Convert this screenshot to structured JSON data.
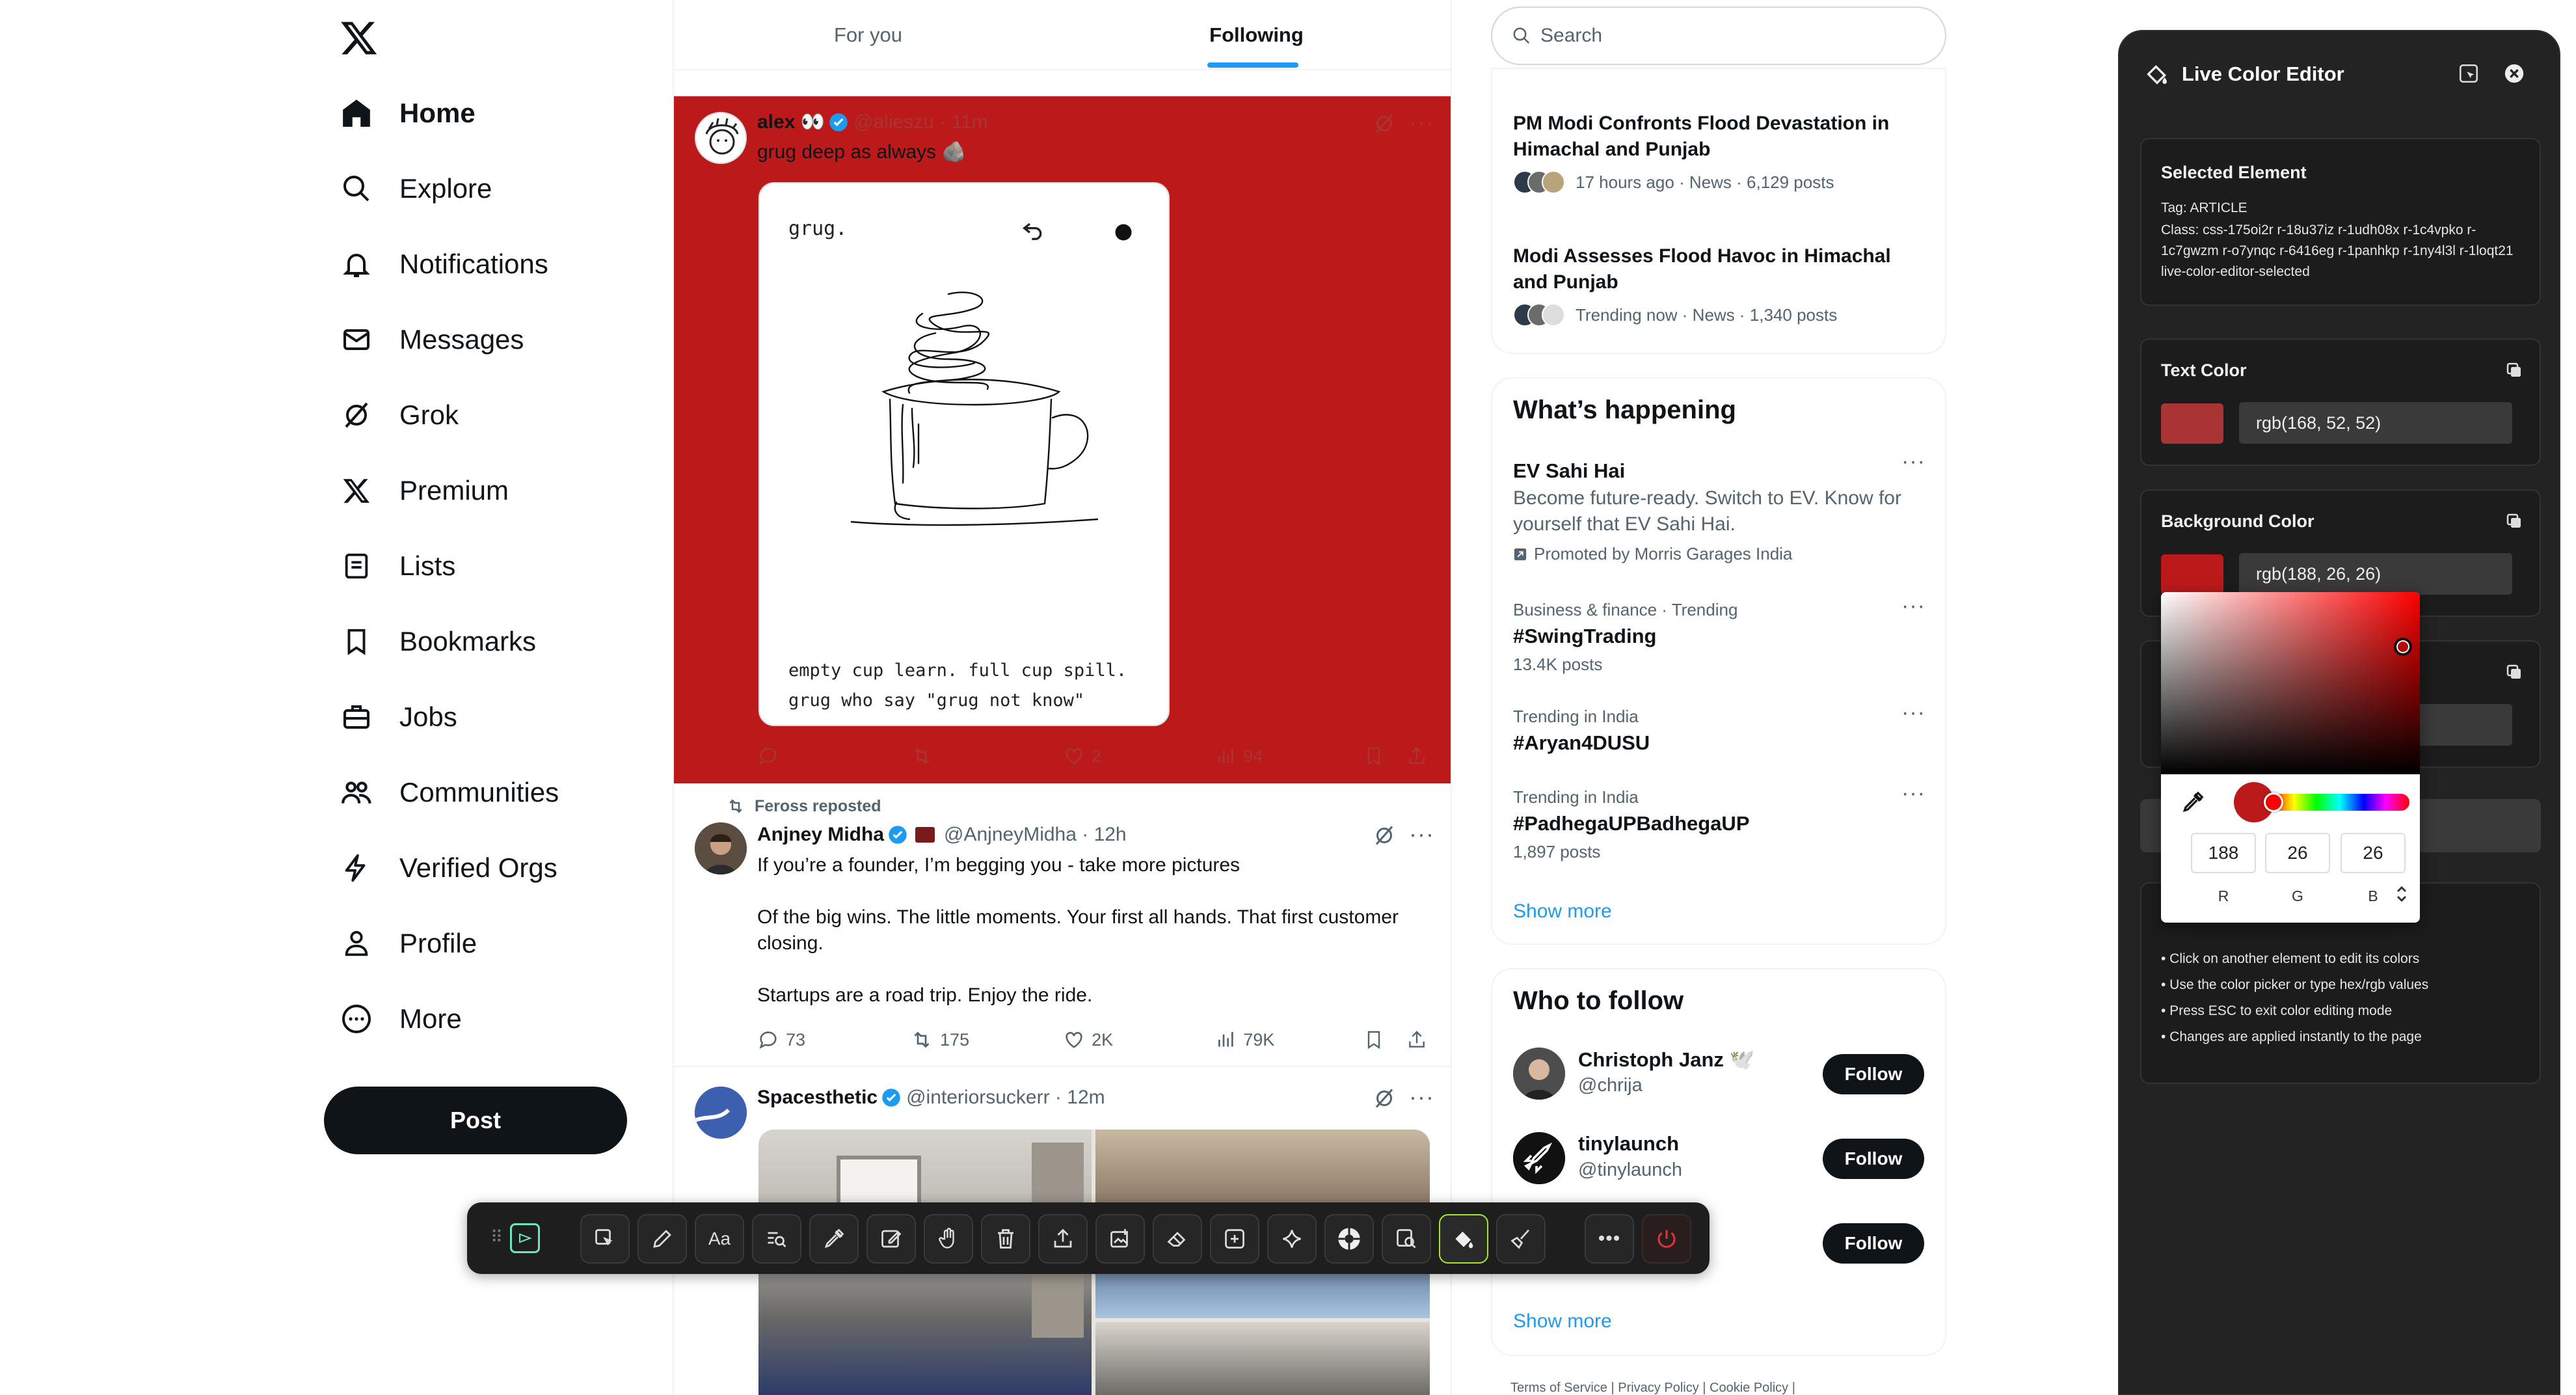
{
  "nav": {
    "items": [
      {
        "label": "Home",
        "icon": "home-icon"
      },
      {
        "label": "Explore",
        "icon": "search-icon"
      },
      {
        "label": "Notifications",
        "icon": "bell-icon"
      },
      {
        "label": "Messages",
        "icon": "envelope-icon"
      },
      {
        "label": "Grok",
        "icon": "grok-icon"
      },
      {
        "label": "Premium",
        "icon": "x-icon"
      },
      {
        "label": "Lists",
        "icon": "list-icon"
      },
      {
        "label": "Bookmarks",
        "icon": "bookmark-icon"
      },
      {
        "label": "Jobs",
        "icon": "briefcase-icon"
      },
      {
        "label": "Communities",
        "icon": "people-icon"
      },
      {
        "label": "Verified Orgs",
        "icon": "lightning-icon"
      },
      {
        "label": "Profile",
        "icon": "person-icon"
      },
      {
        "label": "More",
        "icon": "more-circle-icon"
      }
    ],
    "post_label": "Post"
  },
  "feed": {
    "tabs": [
      "For you",
      "Following"
    ],
    "active_tab": "Following",
    "tweets": [
      {
        "name": "alex 👀",
        "handle": "@alieszu · 11m",
        "text": "grug deep as always 🪨",
        "card": {
          "heading": "grug.",
          "line1": "empty cup learn. full cup spill.",
          "line2": "grug who say \"grug not know\""
        },
        "replies": "",
        "retweets": "",
        "likes": "2",
        "views": "94"
      },
      {
        "repost_note": "Feross reposted",
        "name": "Anjney Midha",
        "handle": "@AnjneyMidha · 12h",
        "text_lines": [
          "If you’re a founder, I’m begging you - take more pictures",
          "Of the big wins. The little moments. Your first all hands. That first customer closing.",
          "Startups are a road trip. Enjoy the ride."
        ],
        "replies": "73",
        "retweets": "175",
        "likes": "2K",
        "views": "79K"
      },
      {
        "name": "Spacesthetic",
        "handle": "@interiorsuckerr · 12m"
      }
    ]
  },
  "right": {
    "search_placeholder": "Search",
    "news": [
      {
        "title": "PM Modi Confronts Flood Devastation in Himachal and Punjab",
        "meta": "17 hours ago · News · 6,129 posts"
      },
      {
        "title": "Modi Assesses Flood Havoc in Himachal and Punjab",
        "meta": "Trending now · News · 1,340 posts"
      }
    ],
    "happening": {
      "title": "What’s happening",
      "promo": {
        "name": "EV Sahi Hai",
        "desc": "Become future-ready. Switch to EV. Know for yourself that EV Sahi Hai.",
        "by": "Promoted by Morris Garages India"
      },
      "trends": [
        {
          "cat": "Business & finance · Trending",
          "name": "#SwingTrading",
          "posts": "13.4K posts"
        },
        {
          "cat": "Trending in India",
          "name": "#Aryan4DUSU",
          "posts": ""
        },
        {
          "cat": "Trending in India",
          "name": "#PadhegaUPBadhegaUP",
          "posts": "1,897 posts"
        }
      ],
      "show_more": "Show more"
    },
    "who_to_follow": {
      "title": "Who to follow",
      "people": [
        {
          "name": "Christoph Janz 🕊️",
          "handle": "@chrija"
        },
        {
          "name": "tinylaunch",
          "handle": "@tinylaunch"
        },
        {
          "name": "",
          "handle": ""
        }
      ],
      "follow_label": "Follow",
      "show_more": "Show more"
    },
    "footer": "Terms of Service  |  Privacy Policy  |  Cookie Policy  |"
  },
  "editor": {
    "title": "Live Color Editor",
    "selected": {
      "heading": "Selected Element",
      "tag": "Tag: ARTICLE",
      "class": "Class: css-175oi2r r-18u37iz r-1udh08x r-1c4vpko r-1c7gwzm r-o7ynqc r-6416eg r-1panhkp r-1ny4l3l r-1loqt21 live-color-editor-selected"
    },
    "text_color": {
      "label": "Text Color",
      "value": "rgb(168, 52, 52)",
      "swatch": "#a83434"
    },
    "bg_color": {
      "label": "Background Color",
      "value": "rgb(188, 26, 26)",
      "swatch": "#bc1a1a"
    },
    "picker": {
      "r": "188",
      "g": "26",
      "b": "26",
      "labels": [
        "R",
        "G",
        "B"
      ]
    },
    "tips": [
      "• Click on another element to edit its colors",
      "• Use the color picker or type hex/rgb values",
      "• Press ESC to exit color editing mode",
      "• Changes are applied instantly to the page"
    ]
  },
  "colors": {
    "accent": "#1d9bf0",
    "tweet_bg": "#bc1a1a",
    "tweet_text": "#a83434",
    "toolbar_active": "#a3e635"
  }
}
